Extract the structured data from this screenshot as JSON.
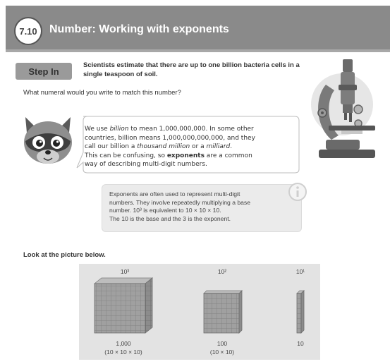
{
  "header": {
    "badge": "7.10",
    "title": "Number: Working with exponents"
  },
  "step_in": {
    "label": "Step In",
    "intro": "Scientists estimate that there are up to one billion bacteria cells in a single teaspoon of soil.",
    "question": "What numeral would you write to match this number?"
  },
  "speech": {
    "line1_pre": "We use ",
    "line1_em": "billion",
    "line1_post": " to mean 1,000,000,000. In some other",
    "line2": "countries, billion means 1,000,000,000,000, and they",
    "line3_pre": "call our billion a ",
    "line3_em1": "thousand million",
    "line3_mid": " or a ",
    "line3_em2": "milliard",
    "line3_post": ".",
    "line4": "This can be confusing, so ",
    "line4_bold": "exponents",
    "line4_post": " are a common",
    "line5": "way of describing multi-digit numbers."
  },
  "info": {
    "line1": "Exponents are often used to represent multi-digit",
    "line2": "numbers. They involve repeatedly multiplying a base",
    "line3": "number. 10³ is equivalent to 10 × 10 × 10.",
    "line4": "The 10 is the base and the 3 is the exponent."
  },
  "picture": {
    "prompt": "Look at the picture below.",
    "blocks": [
      {
        "power": "10³",
        "value": "1,000",
        "expansion": "(10 × 10 × 10)"
      },
      {
        "power": "10²",
        "value": "100",
        "expansion": "(10 × 10)"
      },
      {
        "power": "10¹",
        "value": "10",
        "expansion": ""
      }
    ]
  },
  "colors": {
    "header_bg": "#8a8a8a",
    "panel_bg": "#e3e3e3",
    "cube_face": "#a0a0a0"
  }
}
